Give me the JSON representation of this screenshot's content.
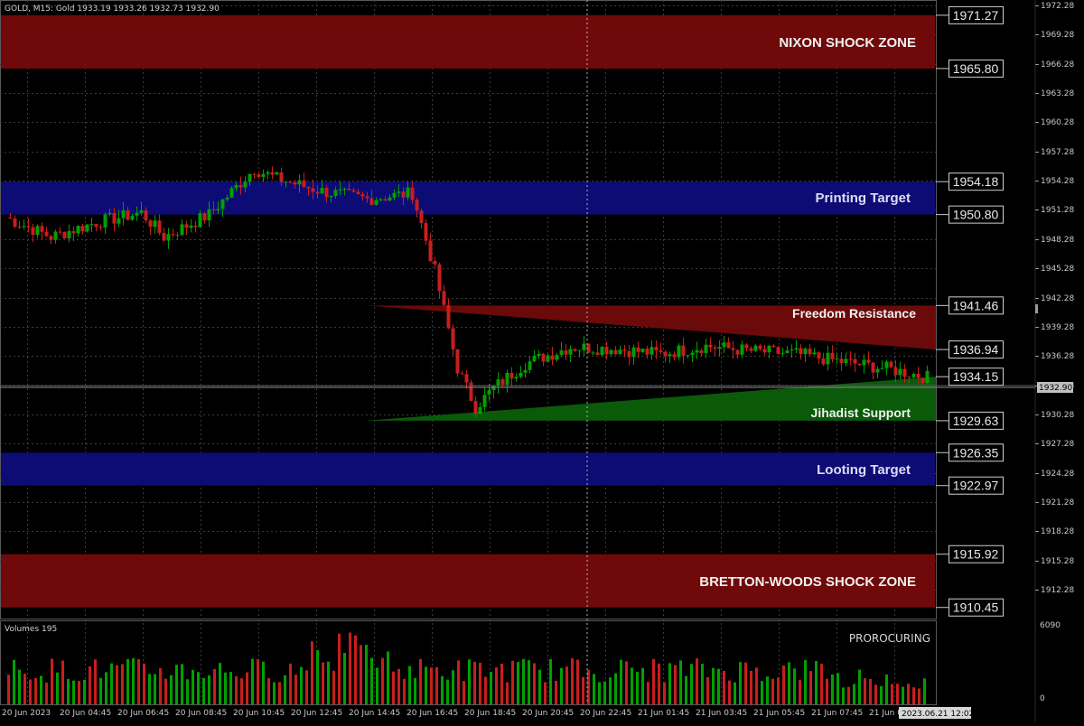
{
  "header": {
    "symbol_line": "GOLD, M15:  Gold  1933.19 1933.26 1932.73 1932.90"
  },
  "colors": {
    "background": "#000000",
    "grid": "#3c3c3c",
    "bull": "#00a000",
    "bear": "#c81e1e",
    "zone_red": "#700a0a",
    "zone_blue": "#0c0c74",
    "zone_green": "#0a5a0a",
    "axis_text": "#c8c8c8"
  },
  "price_axis": {
    "ticks": [
      "1972.28",
      "1969.28",
      "1966.28",
      "1963.28",
      "1960.28",
      "1957.28",
      "1954.28",
      "1951.28",
      "1948.28",
      "1945.28",
      "1942.28",
      "1939.28",
      "1936.28",
      "1933.28",
      "1930.28",
      "1927.28",
      "1924.28",
      "1921.28",
      "1918.28",
      "1915.28",
      "1912.28"
    ],
    "current_price": "1932.90"
  },
  "level_badges": [
    "1971.27",
    "1965.80",
    "1954.18",
    "1950.80",
    "1941.46",
    "1936.94",
    "1934.15",
    "1929.63",
    "1926.35",
    "1922.97",
    "1915.92",
    "1910.45"
  ],
  "zones": {
    "nixon": "NIXON SHOCK ZONE",
    "printing": "Printing Target",
    "freedom": "Freedom Resistance",
    "jihadist": "Jihadist Support",
    "looting": "Looting Target",
    "bretton": "BRETTON-WOODS SHOCK ZONE"
  },
  "volume_panel": {
    "title": "Volumes 195",
    "label": "PROROCURING",
    "max_tick": "6090",
    "min_tick": "0"
  },
  "time_axis": {
    "labels": [
      "20 Jun 2023",
      "20 Jun 04:45",
      "20 Jun 06:45",
      "20 Jun 08:45",
      "20 Jun 10:45",
      "20 Jun 12:45",
      "20 Jun 14:45",
      "20 Jun 16:45",
      "20 Jun 18:45",
      "20 Jun 20:45",
      "20 Jun 22:45",
      "21 Jun 01:45",
      "21 Jun 03:45",
      "21 Jun 05:45",
      "21 Jun 07:45",
      "21 Jun 09:45"
    ],
    "cursor_label": "2023.06.21 12:02"
  }
}
